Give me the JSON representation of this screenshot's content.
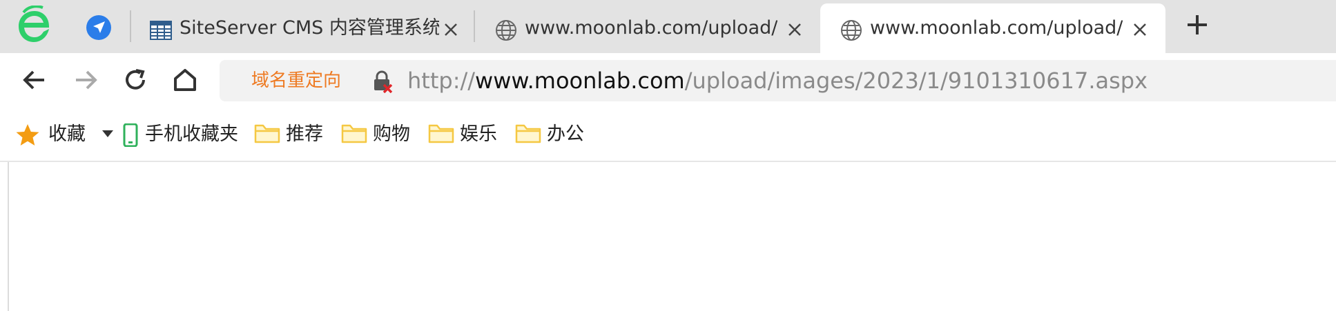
{
  "colors": {
    "tabbar_bg": "#e3e3e3",
    "redirect_orange": "#ee7a22",
    "folder_yellow": "#f5c842",
    "star_orange": "#f39c12",
    "mobile_green": "#2fb15b",
    "logo_green": "#2ecf6a",
    "pin_blue": "#2b7de9",
    "lock_red": "#e0262a"
  },
  "tabs": [
    {
      "title": "SiteServer CMS 内容管理系统",
      "icon": "table-grid-icon"
    },
    {
      "title": "www.moonlab.com/upload/",
      "icon": "globe-icon"
    },
    {
      "title": "www.moonlab.com/upload/",
      "icon": "globe-icon",
      "active": true
    }
  ],
  "address": {
    "redirect_label": "域名重定向",
    "url_scheme": "http://",
    "url_host": "www.moonlab.com",
    "url_path": "/upload/images/2023/1/9101310617.aspx",
    "lock_icon": "lock-insecure-icon"
  },
  "bookmarks": {
    "favorites_label": "收藏",
    "mobile_label": "手机收藏夹",
    "folders": [
      "推荐",
      "购物",
      "娱乐",
      "办公"
    ]
  }
}
